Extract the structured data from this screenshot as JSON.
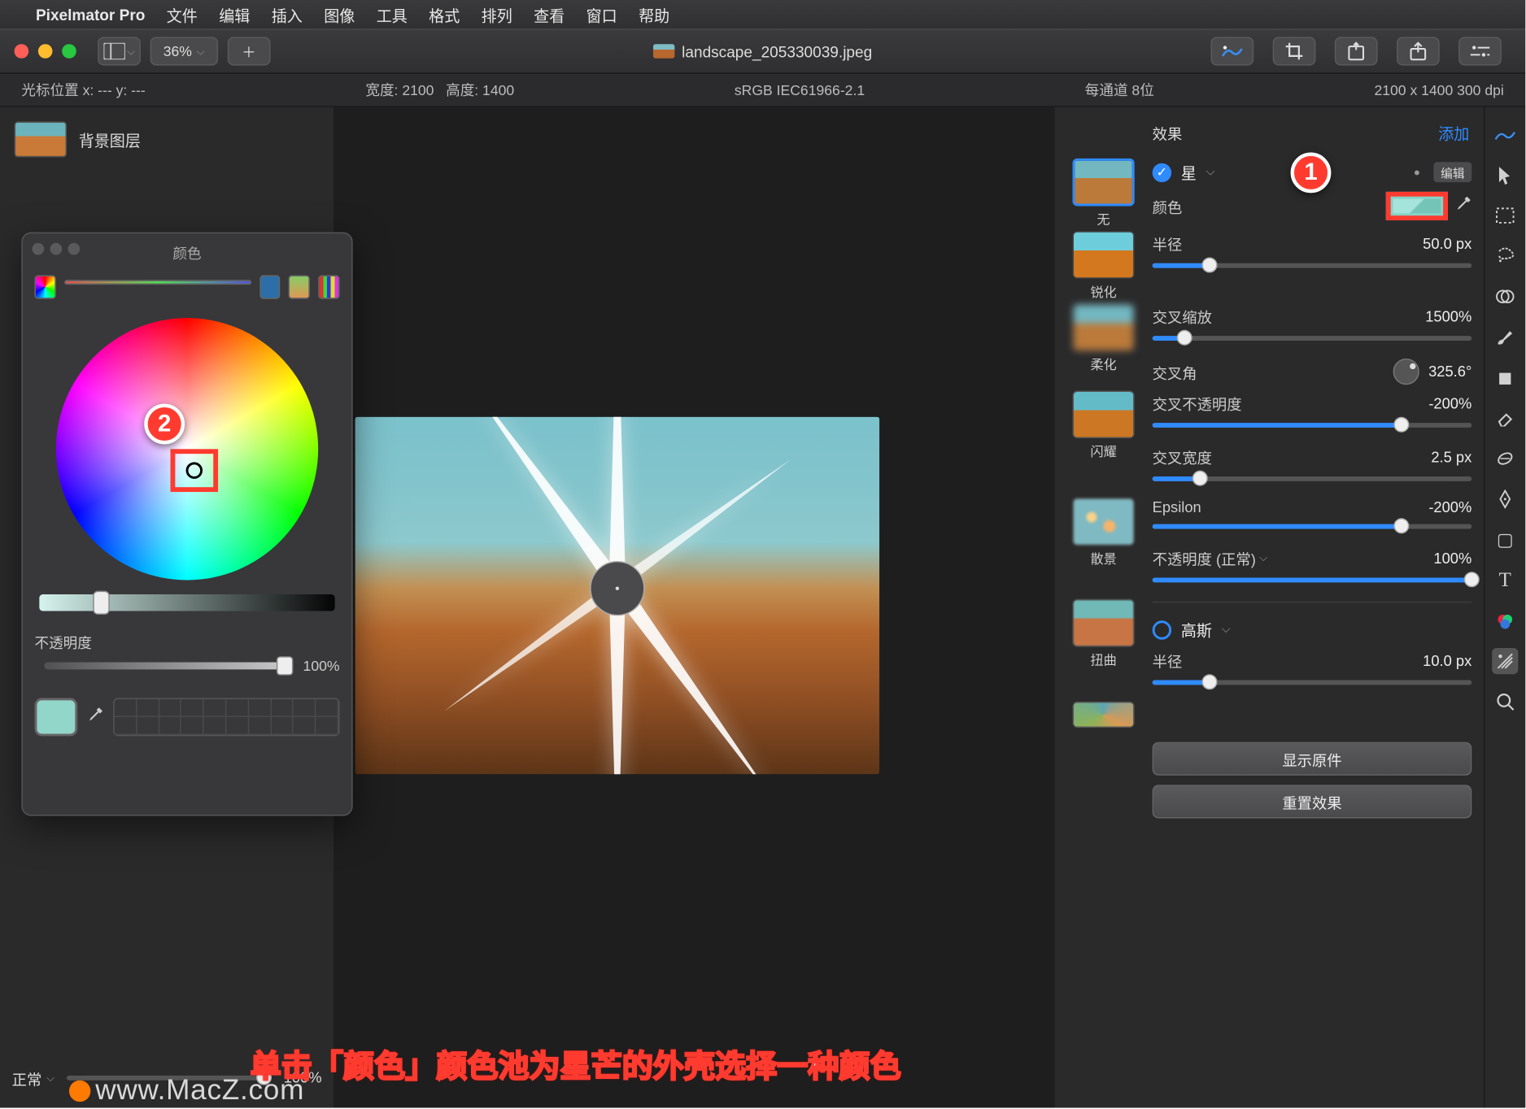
{
  "menubar": {
    "app": "Pixelmator Pro",
    "items": [
      "文件",
      "编辑",
      "插入",
      "图像",
      "工具",
      "格式",
      "排列",
      "查看",
      "窗口",
      "帮助"
    ]
  },
  "toolbar": {
    "zoom": "36%",
    "doc_title": "landscape_205330039.jpeg"
  },
  "infobar": {
    "cursor": "光标位置 x:  ---      y:  ---",
    "width": "宽度:  2100",
    "height": "高度:  1400",
    "profile": "sRGB IEC61966-2.1",
    "depth": "每通道 8位",
    "dims": "2100 x 1400 300 dpi"
  },
  "layers": {
    "bg": "背景图层"
  },
  "colors_panel": {
    "title": "颜色",
    "opacity_label": "不透明度",
    "opacity_value": "100%"
  },
  "badges": {
    "b1": "1",
    "b2": "2"
  },
  "blend": {
    "mode": "正常",
    "value": "100%"
  },
  "fx": {
    "title": "效果",
    "add": "添加",
    "categories": [
      "无",
      "锐化",
      "柔化",
      "闪耀",
      "散景",
      "扭曲"
    ],
    "star": {
      "name": "星",
      "edit": "编辑",
      "color_label": "颜色",
      "radius_label": "半径",
      "radius_value": "50.0 px",
      "cross_scale_label": "交叉缩放",
      "cross_scale_value": "1500%",
      "cross_angle_label": "交叉角",
      "cross_angle_value": "325.6°",
      "cross_opacity_label": "交叉不透明度",
      "cross_opacity_value": "-200%",
      "cross_width_label": "交叉宽度",
      "cross_width_value": "2.5 px",
      "epsilon_label": "Epsilon",
      "epsilon_value": "-200%",
      "opacity_label": "不透明度 (正常)",
      "opacity_value": "100%"
    },
    "gauss": {
      "name": "高斯",
      "radius_label": "半径",
      "radius_value": "10.0 px"
    },
    "show_original": "显示原件",
    "reset": "重置效果"
  },
  "caption": "单击「颜色」颜色池为星芒的外壳选择一种颜色",
  "watermark": "www.MacZ.com"
}
